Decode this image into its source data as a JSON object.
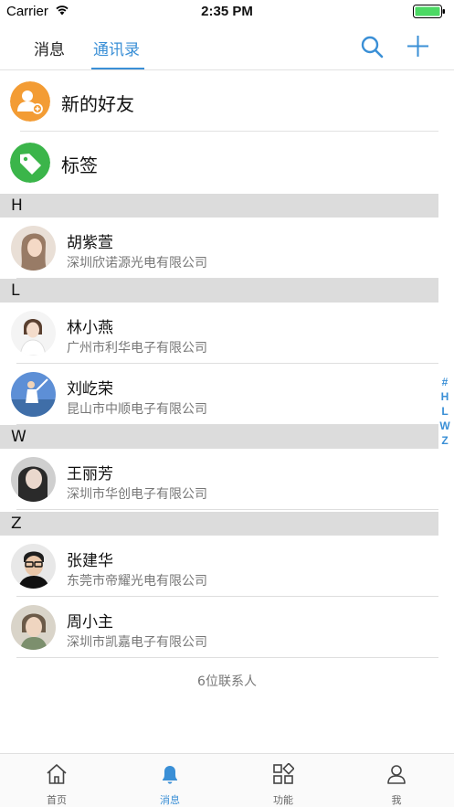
{
  "status_bar": {
    "carrier": "Carrier",
    "time": "2:35 PM"
  },
  "header": {
    "tabs": [
      {
        "label": "消息",
        "active": false
      },
      {
        "label": "通讯录",
        "active": true
      }
    ],
    "search_icon": "search-icon",
    "add_icon": "plus-icon"
  },
  "fixed_entries": [
    {
      "label": "新的好友",
      "icon": "add-user-icon",
      "color": "#f39c34"
    },
    {
      "label": "标签",
      "icon": "tag-icon",
      "color": "#3bb54a"
    }
  ],
  "sections": [
    {
      "letter": "H",
      "contacts": [
        {
          "name": "胡紫萱",
          "company": "深圳欣诺源光电有限公司"
        }
      ]
    },
    {
      "letter": "L",
      "contacts": [
        {
          "name": "林小燕",
          "company": "广州市利华电子有限公司"
        },
        {
          "name": "刘屹荣",
          "company": "昆山市中顺电子有限公司"
        }
      ]
    },
    {
      "letter": "W",
      "contacts": [
        {
          "name": "王丽芳",
          "company": "深圳市华创电子有限公司"
        }
      ]
    },
    {
      "letter": "Z",
      "contacts": [
        {
          "name": "张建华",
          "company": "东莞市帝耀光电有限公司"
        },
        {
          "name": "周小主",
          "company": "深圳市凯嘉电子有限公司"
        }
      ]
    }
  ],
  "index_bar": [
    "#",
    "H",
    "L",
    "W",
    "Z"
  ],
  "contact_count": "6位联系人",
  "tab_bar": [
    {
      "label": "首页",
      "icon": "home-icon",
      "active": false
    },
    {
      "label": "消息",
      "icon": "bell-icon",
      "active": true
    },
    {
      "label": "功能",
      "icon": "grid-icon",
      "active": false
    },
    {
      "label": "我",
      "icon": "user-icon",
      "active": false
    }
  ],
  "colors": {
    "accent": "#3a8fd6",
    "section_bg": "#dcdcdc",
    "new_friend": "#f39c34",
    "tags": "#3bb54a"
  }
}
